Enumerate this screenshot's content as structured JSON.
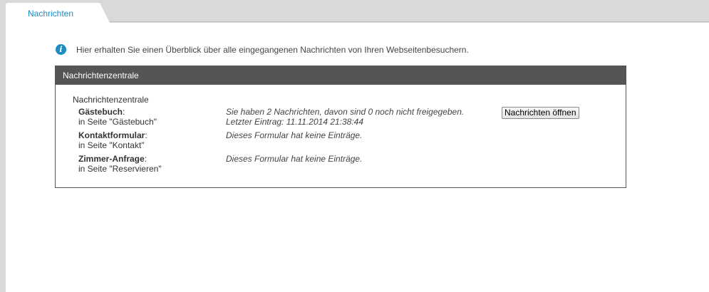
{
  "tab": {
    "label": "Nachrichten"
  },
  "info": {
    "text": "Hier erhalten Sie einen Überblick über alle eingegangenen Nachrichten von Ihren Webseitenbesuchern."
  },
  "panel": {
    "header": "Nachrichtenzentrale",
    "section_title": "Nachrichtenzentrale",
    "rows": [
      {
        "name": "Gästebuch",
        "colon": ":",
        "page": "in Seite \"Gästebuch\"",
        "message": "Sie haben 2 Nachrichten, davon sind 0 noch nicht freigegeben.",
        "last_entry": "Letzter Eintrag: 11.11.2014 21:38:44",
        "button_label": "Nachrichten öffnen"
      },
      {
        "name": "Kontaktformular",
        "colon": ":",
        "page": "in Seite \"Kontakt\"",
        "message": "Dieses Formular hat keine Einträge."
      },
      {
        "name": "Zimmer-Anfrage",
        "colon": ":",
        "page": "in Seite \"Reservieren\"",
        "message": "Dieses Formular hat keine Einträge."
      }
    ]
  },
  "colors": {
    "accent": "#1e8bc3",
    "header_bg": "#555555",
    "chrome_bg": "#d9d9d9"
  }
}
